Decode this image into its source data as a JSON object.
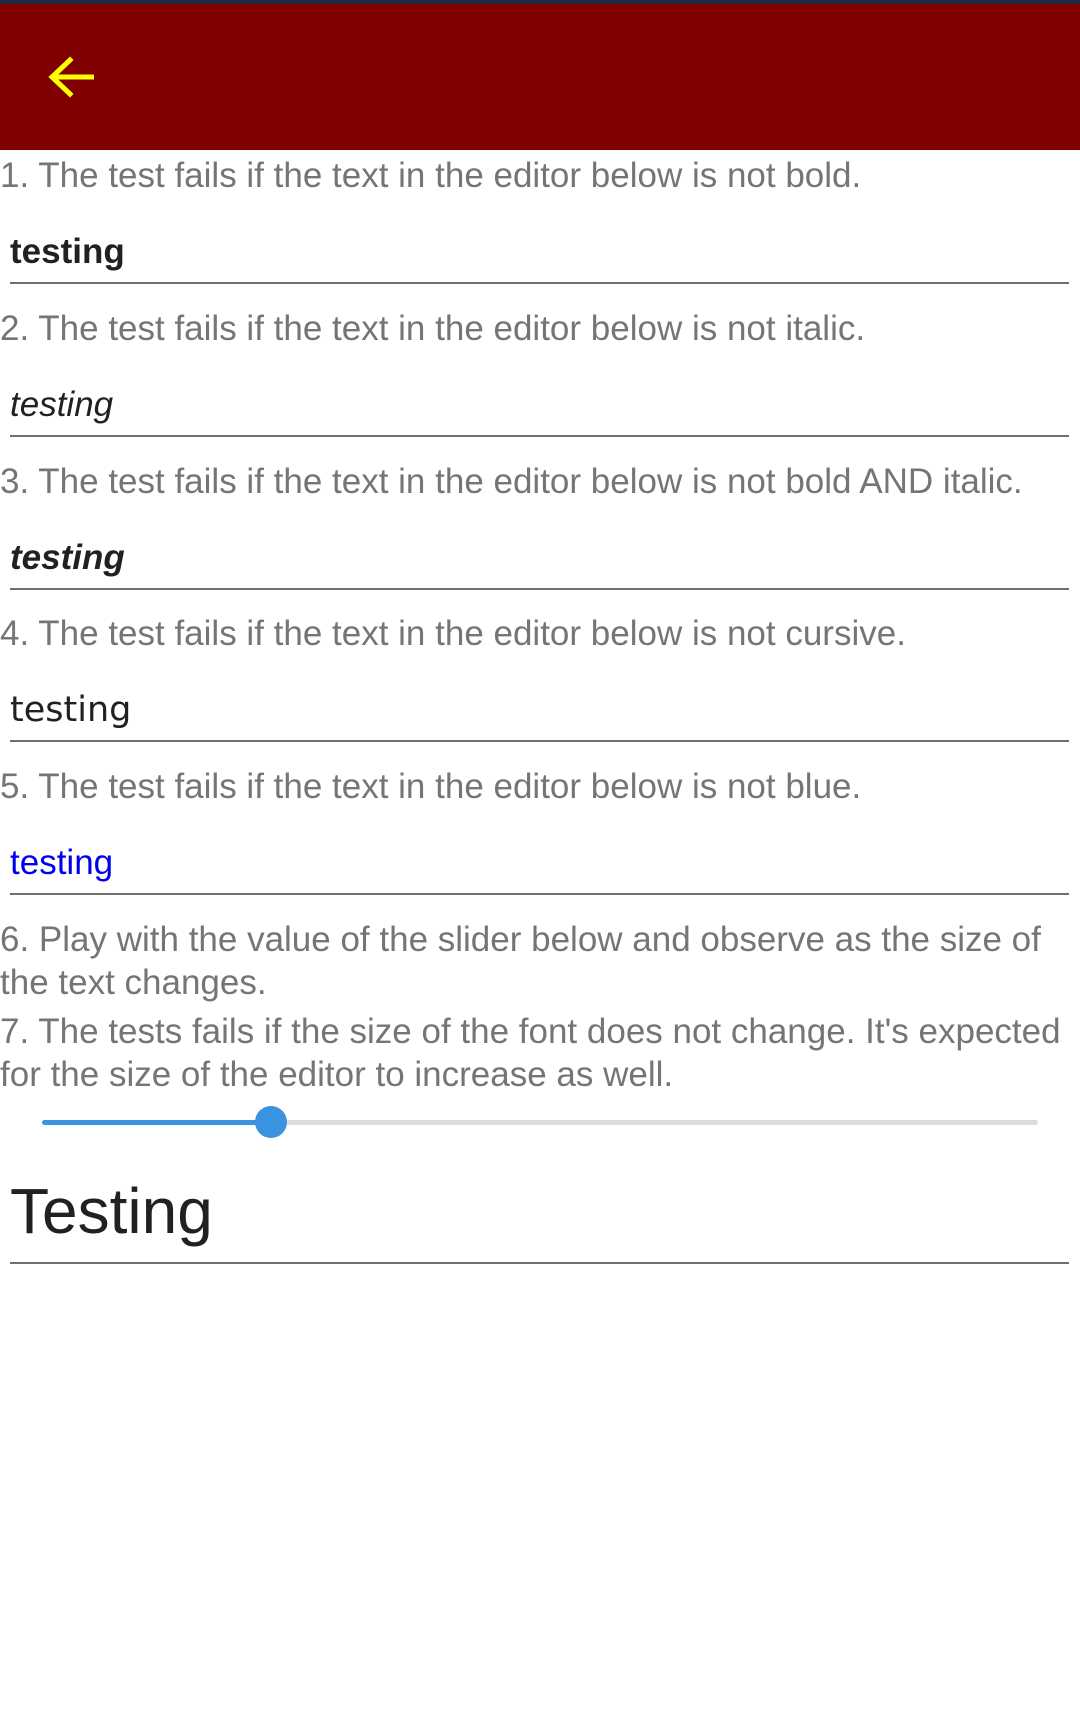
{
  "toolbar": {
    "back_icon": "arrow-left-icon",
    "back_icon_color": "#FFFF00",
    "background": "#800000"
  },
  "tests": [
    {
      "instruction": "1. The test fails if the text in the editor below is not bold.",
      "editor_text": "testing",
      "style": "bold"
    },
    {
      "instruction": "2. The test fails if the text in the editor below is not italic.",
      "editor_text": "testing",
      "style": "italic"
    },
    {
      "instruction": "3. The test fails if the text in the editor below is not bold AND italic.",
      "editor_text": "testing",
      "style": "bold-italic"
    },
    {
      "instruction": "4. The test fails if the text in the editor below is not cursive.",
      "editor_text": "testing",
      "style": "cursive"
    },
    {
      "instruction": "5. The test fails if the text in the editor below is not blue.",
      "editor_text": "testing",
      "style": "blue",
      "text_color": "#0000EE"
    }
  ],
  "slider_section": {
    "instruction_6": "6. Play with the value of the slider below and observe as the size of the text changes.",
    "instruction_7": "7. The tests fails if the size of the font does not change. It's expected for the size of the editor to increase as well.",
    "slider_value": 0.23,
    "accent_color": "#3A93DE",
    "editor_text": "Testing"
  }
}
